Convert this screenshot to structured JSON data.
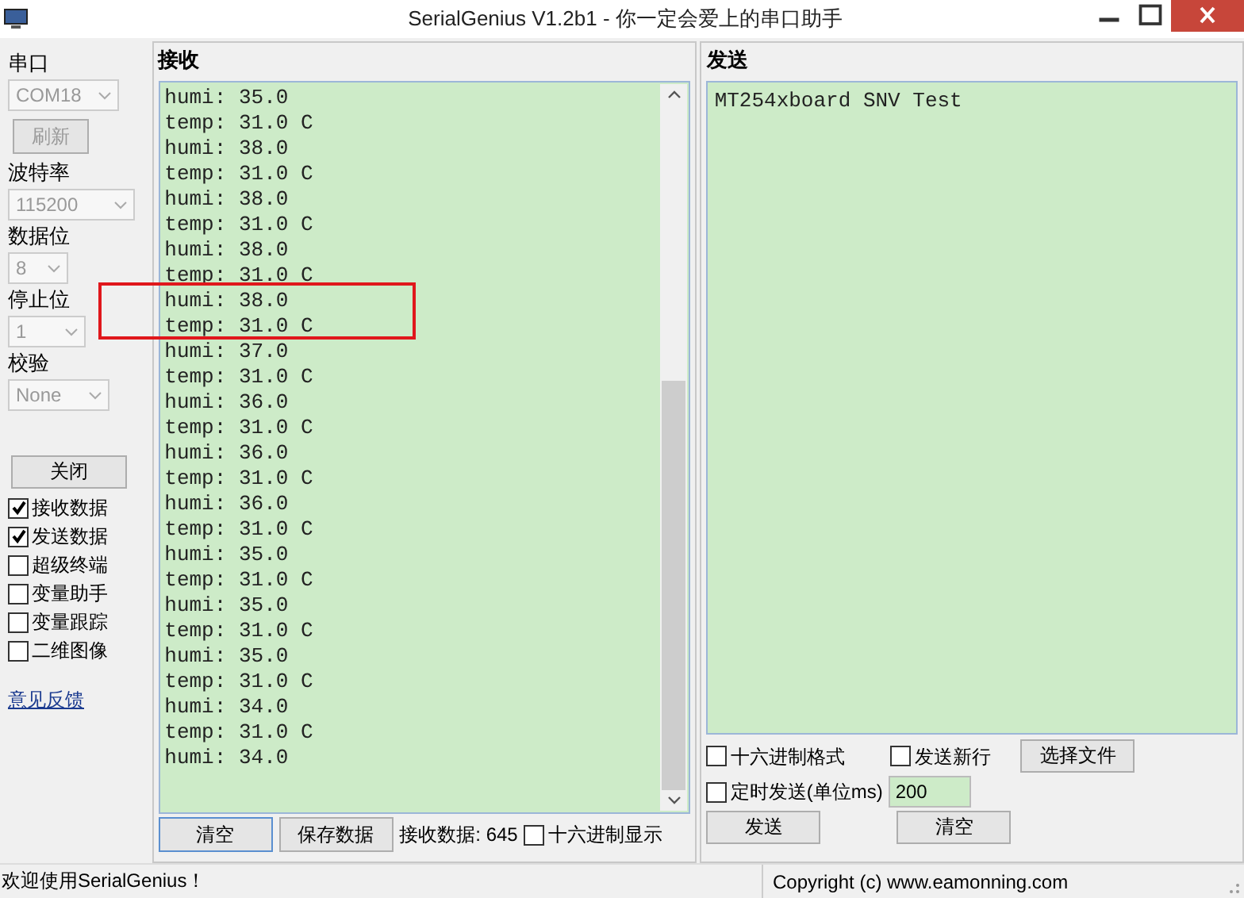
{
  "window": {
    "title": "SerialGenius V1.2b1 - 你一定会爱上的串口助手"
  },
  "settings": {
    "fields": [
      {
        "label": "串口",
        "value": "COM18",
        "disabled": true
      },
      {
        "label": "波特率",
        "value": "115200",
        "disabled": true
      },
      {
        "label": "数据位",
        "value": "8",
        "disabled": true
      },
      {
        "label": "停止位",
        "value": "1",
        "disabled": true
      },
      {
        "label": "校验",
        "value": "None",
        "disabled": true
      }
    ],
    "refresh_button": {
      "label": "刷新",
      "disabled": true
    },
    "close_button": "关闭",
    "options": [
      {
        "label": "接收数据",
        "checked": true
      },
      {
        "label": "发送数据",
        "checked": true
      },
      {
        "label": "超级终端",
        "checked": false
      },
      {
        "label": "变量助手",
        "checked": false
      },
      {
        "label": "变量跟踪",
        "checked": false
      },
      {
        "label": "二维图像",
        "checked": false
      }
    ],
    "feedback_link": "意见反馈"
  },
  "receive": {
    "title": "接收",
    "lines": [
      "humi: 35.0",
      "temp: 31.0 C",
      "humi: 38.0",
      "temp: 31.0 C",
      "humi: 38.0",
      "temp: 31.0 C",
      "humi: 38.0",
      "temp: 31.0 C",
      "humi: 38.0",
      "temp: 31.0 C",
      "humi: 37.0",
      "temp: 31.0 C",
      "humi: 36.0",
      "temp: 31.0 C",
      "humi: 36.0",
      "temp: 31.0 C",
      "humi: 36.0",
      "temp: 31.0 C",
      "humi: 35.0",
      "temp: 31.0 C",
      "humi: 35.0",
      "temp: 31.0 C",
      "humi: 35.0",
      "temp: 31.0 C",
      "humi: 34.0",
      "temp: 31.0 C",
      "humi: 34.0"
    ],
    "clear_button": "清空",
    "save_button": "保存数据",
    "count": "接收数据: 645",
    "hex_display": {
      "label": "十六进制显示",
      "checked": false
    }
  },
  "send": {
    "title": "发送",
    "text": "MT254xboard SNV Test",
    "hex_format": {
      "label": "十六进制格式",
      "checked": false
    },
    "newline": {
      "label": "发送新行",
      "checked": false
    },
    "file_button": "选择文件",
    "timed": {
      "label": "定时发送(单位ms)",
      "checked": false
    },
    "interval": "200",
    "send_button": "发送",
    "clear_button": "清空"
  },
  "status_bar": {
    "message": "欢迎使用SerialGenius！",
    "copyright": "Copyright (c) www.eamonning.com"
  }
}
